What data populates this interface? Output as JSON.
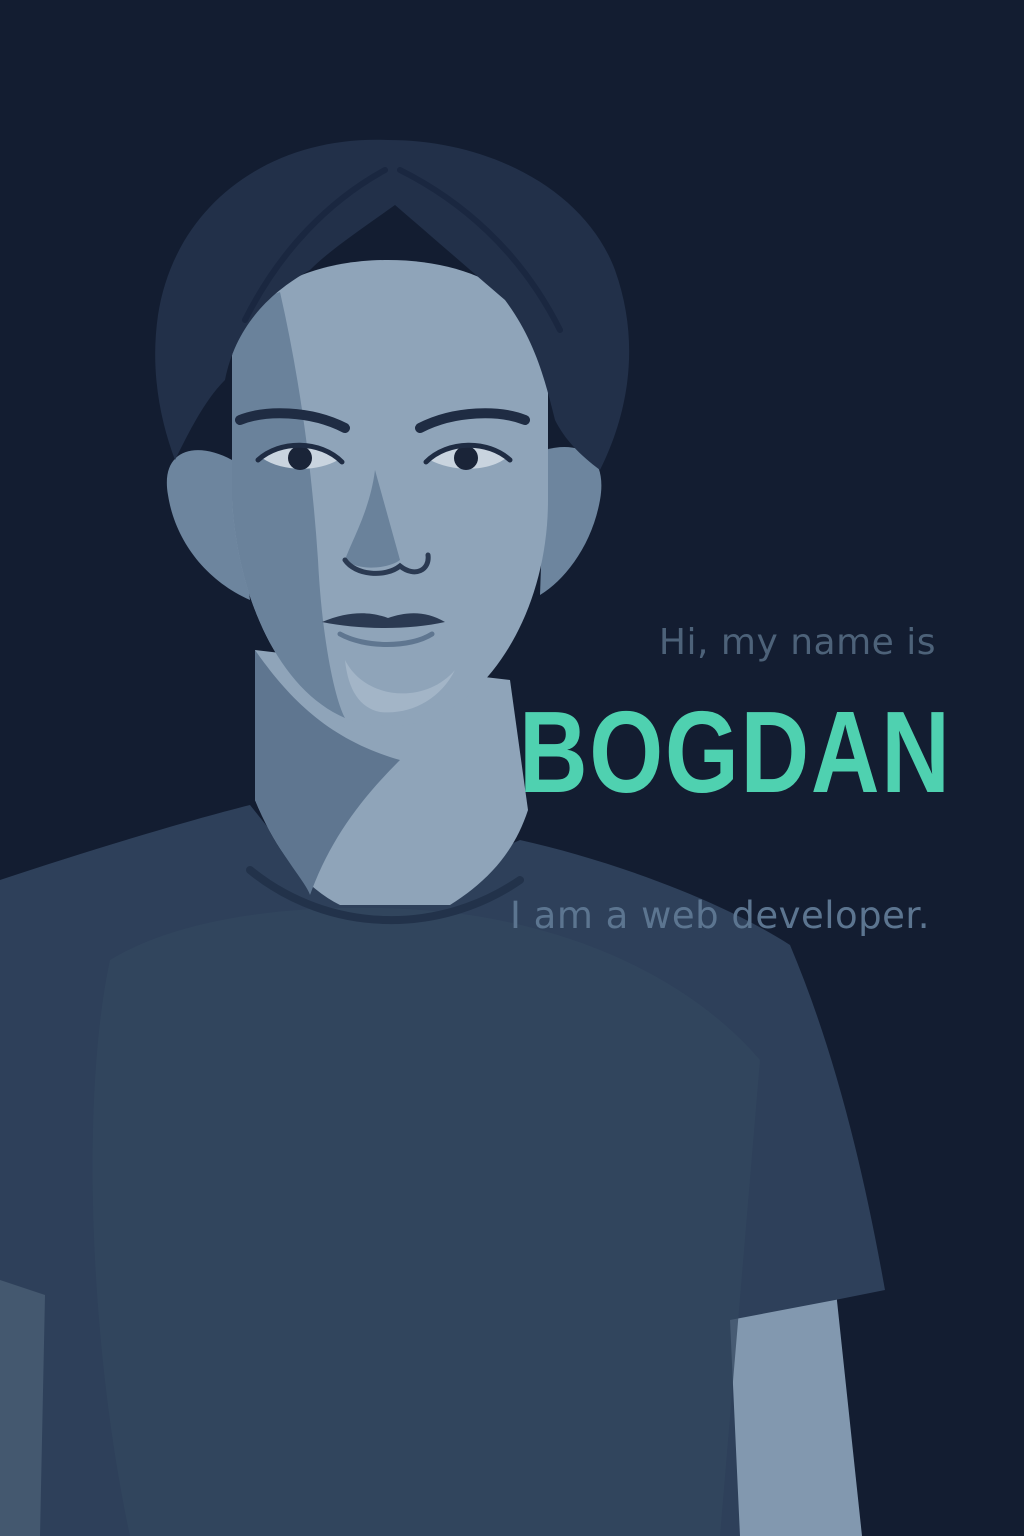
{
  "hero": {
    "greeting": "Hi, my name is",
    "name": "BOGDAN",
    "tagline": "I am a web developer."
  },
  "colors": {
    "background": "#131d31",
    "accent": "#4fd1b0",
    "muted_text": "#4d6279",
    "skin_light": "#8fa4b9",
    "skin_mid": "#6d859e",
    "hair": "#223049",
    "shirt": "#2f425c"
  },
  "portrait": {
    "icon": "person-illustration"
  }
}
